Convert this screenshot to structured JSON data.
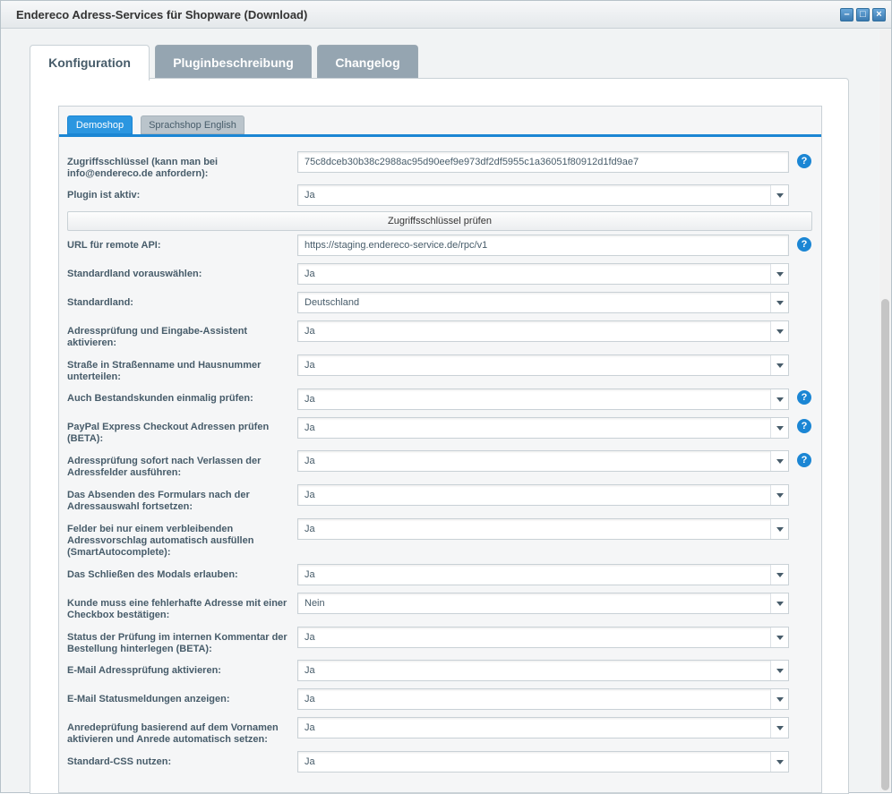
{
  "window": {
    "title": "Endereco Adress-Services für Shopware (Download)"
  },
  "tabs": [
    {
      "label": "Konfiguration"
    },
    {
      "label": "Pluginbeschreibung"
    },
    {
      "label": "Changelog"
    }
  ],
  "shop_tabs": [
    {
      "label": "Demoshop"
    },
    {
      "label": "Sprachshop English"
    }
  ],
  "check_button": {
    "label": "Zugriffsschlüssel prüfen"
  },
  "fields": [
    {
      "label": "Zugriffsschlüssel (kann man bei info@endereco.de anfordern):",
      "value": "75c8dceb30b38c2988ac95d90eef9e973df2df5955c1a36051f80912d1fd9ae7"
    },
    {
      "label": "Plugin ist aktiv:",
      "value": "Ja"
    },
    {
      "label": "URL für remote API:",
      "value": "https://staging.endereco-service.de/rpc/v1"
    },
    {
      "label": "Standardland vorauswählen:",
      "value": "Ja"
    },
    {
      "label": "Standardland:",
      "value": "Deutschland"
    },
    {
      "label": "Adressprüfung und Eingabe-Assistent aktivieren:",
      "value": "Ja"
    },
    {
      "label": "Straße in Straßenname und Hausnummer unterteilen:",
      "value": "Ja"
    },
    {
      "label": "Auch Bestandskunden einmalig prüfen:",
      "value": "Ja"
    },
    {
      "label": "PayPal Express Checkout Adressen prüfen (BETA):",
      "value": "Ja"
    },
    {
      "label": "Adressprüfung sofort nach Verlassen der Adressfelder ausführen:",
      "value": "Ja"
    },
    {
      "label": "Das Absenden des Formulars nach der Adressauswahl fortsetzen:",
      "value": "Ja"
    },
    {
      "label": "Felder bei nur einem verbleibenden Adressvorschlag automatisch ausfüllen (SmartAutocomplete):",
      "value": "Ja"
    },
    {
      "label": "Das Schließen des Modals erlauben:",
      "value": "Ja"
    },
    {
      "label": "Kunde muss eine fehlerhafte Adresse mit einer Checkbox bestätigen:",
      "value": "Nein"
    },
    {
      "label": "Status der Prüfung im internen Kommentar der Bestellung hinterlegen (BETA):",
      "value": "Ja"
    },
    {
      "label": "E-Mail Adressprüfung aktivieren:",
      "value": "Ja"
    },
    {
      "label": "E-Mail Statusmeldungen anzeigen:",
      "value": "Ja"
    },
    {
      "label": "Anredeprüfung basierend auf dem Vornamen aktivieren und Anrede automatisch setzen:",
      "value": "Ja"
    },
    {
      "label": "Standard-CSS nutzen:",
      "value": "Ja"
    }
  ]
}
